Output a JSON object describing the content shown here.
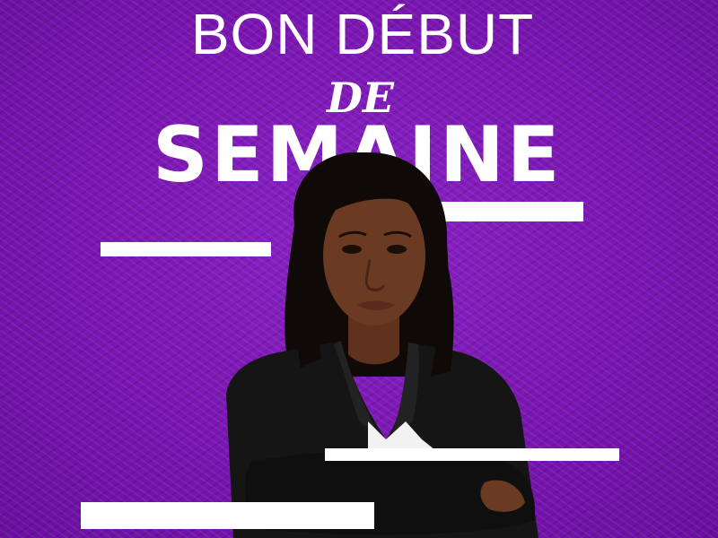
{
  "headline": {
    "line1": "BON DÉBUT",
    "line2": "DE",
    "line3": "SEMAINE"
  },
  "colors": {
    "background": "#7d18b8",
    "text": "#ffffff",
    "accent_bars": "#ffffff",
    "jacket": "#151515",
    "skin": "#6b3a22",
    "hair": "#0f0a08"
  },
  "decorations": {
    "photo_subject": "woman-arms-crossed-portrait",
    "bars": [
      "bar-right-top",
      "bar-left-top",
      "bar-right-bottom",
      "bar-left-bottom"
    ]
  }
}
